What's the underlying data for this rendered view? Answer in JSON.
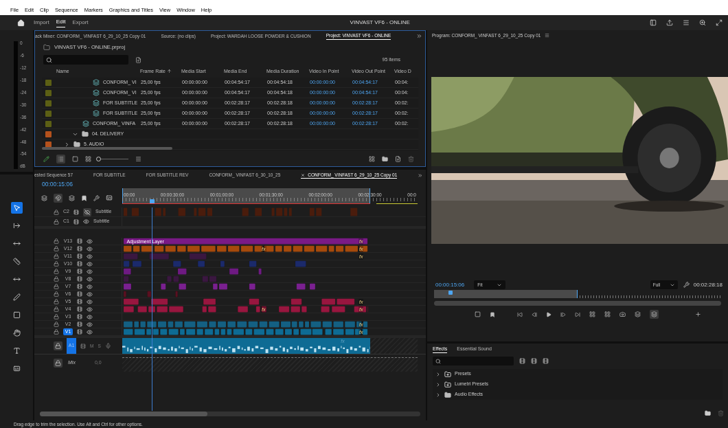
{
  "menu": [
    "File",
    "Edit",
    "Clip",
    "Sequence",
    "Markers",
    "Graphics and Titles",
    "View",
    "Window",
    "Help"
  ],
  "workspaces": [
    {
      "label": "Import",
      "selected": false
    },
    {
      "label": "Edit",
      "selected": true
    },
    {
      "label": "Export",
      "selected": false
    }
  ],
  "window": {
    "title": "VINVAST VF6 - ONLINE"
  },
  "meter": {
    "scale": [
      "0",
      "-6",
      "-12",
      "-18",
      "-24",
      "-30",
      "-36",
      "-42",
      "-48",
      "-54",
      "dB"
    ]
  },
  "tools": [
    {
      "kind": "select",
      "selected": true
    },
    {
      "kind": "track",
      "selected": false
    },
    {
      "kind": "ripple",
      "selected": false
    },
    {
      "kind": "razor",
      "selected": false
    },
    {
      "kind": "slip",
      "selected": false
    },
    {
      "kind": "pen",
      "selected": false
    },
    {
      "kind": "rect",
      "selected": false
    },
    {
      "kind": "hand",
      "selected": false
    },
    {
      "kind": "type",
      "selected": false
    },
    {
      "kind": "caption",
      "selected": false
    }
  ],
  "project": {
    "tabs": [
      {
        "label": "ack Mixer: CONFORM_ VINFAST 6_29_10_25 Copy 01",
        "selected": false
      },
      {
        "label": "Source: (no clips)",
        "selected": false
      },
      {
        "label": "Project: WARDAH LOOSE POWDER & CUSHION",
        "selected": false
      },
      {
        "label": "Project: VINVAST VF6 - ONLINE",
        "selected": true
      }
    ],
    "path": "VINVAST VF6 - ONLINE.prproj",
    "count": "95 items",
    "zoom": {
      "level": 0
    },
    "columns": [
      "Name",
      "Frame Rate",
      "Media Start",
      "Media End",
      "Media Duration",
      "Video In Point",
      "Video Out Point",
      "Video D"
    ],
    "rows": [
      {
        "kind": "continued",
        "children": [
          {
            "kind": "continued",
            "children": [
              {
                "kind": "sequence",
                "color": "#5c5f14",
                "name": "CONFORM_ VI",
                "cells": [
                  "25,00 fps",
                  "00:00:00:00",
                  "00:04:54:17",
                  "00:04:54:18",
                  "00:00:00:00",
                  "00:04:54:17",
                  "00:04:"
                ]
              },
              {
                "kind": "sequence",
                "color": "#5c5f14",
                "name": "CONFORM_ VI",
                "cells": [
                  "25,00 fps",
                  "00:00:00:00",
                  "00:04:54:17",
                  "00:04:54:18",
                  "00:00:00:00",
                  "00:04:54:17",
                  "00:04:"
                ]
              },
              {
                "kind": "sequence",
                "color": "#5c5f14",
                "name": "FOR SUBTITLE",
                "cells": [
                  "25,00 fps",
                  "00:00:00:00",
                  "00:02:28:17",
                  "00:02:28:18",
                  "00:00:00:00",
                  "00:02:28:17",
                  "00:02:"
                ]
              },
              {
                "kind": "sequence",
                "color": "#5c5f14",
                "name": "FOR SUBTITLE",
                "cells": [
                  "25,00 fps",
                  "00:00:00:00",
                  "00:02:28:17",
                  "00:02:28:18",
                  "00:00:00:00",
                  "00:02:28:17",
                  "00:02:"
                ]
              }
            ]
          },
          {
            "kind": "sequence",
            "color": "#5c5f14",
            "name": "CONFORM_ VINFA",
            "cells": [
              "25,00 fps",
              "00:00:00:00",
              "00:02:28:17",
              "00:02:28:18",
              "00:00:00:00",
              "00:02:28:17",
              "00:02:"
            ]
          },
          {
            "kind": "folder",
            "color": "#b4511c",
            "name": "04. DELIVERY",
            "expanded": true
          }
        ]
      },
      {
        "kind": "folder",
        "color": "#b4511c",
        "name": "5. AUDIO",
        "expanded": false
      }
    ]
  },
  "timeline": {
    "tabs": [
      {
        "label": "ested Sequence 57",
        "selected": false
      },
      {
        "label": "FOR SUBTITLE",
        "selected": false
      },
      {
        "label": "FOR SUBTITLE REV",
        "selected": false
      },
      {
        "label": "CONFORM_ VINFAST 6_30_10_25",
        "selected": false
      },
      {
        "label": "CONFORM_ VINFAST 6_29_10_25 Copy 01",
        "selected": true
      }
    ],
    "timecode": "00:00:15:06",
    "playhead": {
      "level": 0.1
    },
    "ruler": [
      "00:00",
      "00:00:30:00",
      "00:01:00:00",
      "00:01:30:00",
      "00:02:00:00",
      "00:02:30:00",
      "00:0"
    ],
    "caption_tracks": [
      {
        "name": "C2",
        "label": "Subtitle",
        "visible": false
      },
      {
        "name": "C1",
        "label": "Subtitle",
        "visible": true
      }
    ],
    "video_tracks": [
      {
        "name": "V13",
        "selected": false,
        "color": "#7a1a86",
        "label": "Adjustment Layer",
        "badges": [
          "fx"
        ]
      },
      {
        "name": "V12",
        "selected": false,
        "color": "#a64a0c",
        "badges": [
          "fx",
          "fx"
        ]
      },
      {
        "name": "V11",
        "selected": false,
        "color": "#3a1740",
        "badges": [
          "fx"
        ]
      },
      {
        "name": "V10",
        "selected": false,
        "color": "#1b2a6b"
      },
      {
        "name": "V9",
        "selected": false,
        "color": "#6e1a82"
      },
      {
        "name": "V8",
        "selected": false,
        "color": "#3a1740"
      },
      {
        "name": "V7",
        "selected": false,
        "color": "#7a2090"
      },
      {
        "name": "V6",
        "selected": false,
        "color": "#5a1020"
      },
      {
        "name": "V5",
        "selected": false,
        "color": "#98163f",
        "badges": [
          "fx"
        ]
      },
      {
        "name": "V4",
        "selected": false,
        "color": "#98163f",
        "badges": [
          "fx",
          "fx"
        ]
      },
      {
        "name": "V3",
        "selected": false
      },
      {
        "name": "V2",
        "selected": false,
        "color": "#146083",
        "badges": [
          "fx"
        ]
      },
      {
        "name": "V1",
        "selected": true,
        "color": "#0e6b94",
        "badges": [
          "fx"
        ]
      }
    ],
    "audio_tracks": [
      {
        "name": "A1",
        "selected": true,
        "mute": "M",
        "solo": "S",
        "badges": [
          "fx"
        ]
      }
    ],
    "mix": {
      "label": "Mix",
      "value": "0,0"
    }
  },
  "program": {
    "title": "Program: CONFORM_ VINFAST 6_29_10_25 Copy 01",
    "timecode": "00:00:15:06",
    "fit": "Fit",
    "quality": "Full",
    "duration": "00:02:28:18",
    "playhead": {
      "level": 0.05
    }
  },
  "effects": {
    "tabs": [
      {
        "label": "Effects",
        "selected": true
      },
      {
        "label": "Essential Sound",
        "selected": false
      }
    ],
    "items": [
      {
        "label": "Presets",
        "kind": "preset",
        "expanded": false
      },
      {
        "label": "Lumetri Presets",
        "kind": "preset",
        "expanded": false
      },
      {
        "label": "Audio Effects",
        "kind": "folder",
        "expanded": false
      }
    ]
  },
  "status_bar": "Drag edge to trim the selection. Use Alt and Ctrl for other options."
}
